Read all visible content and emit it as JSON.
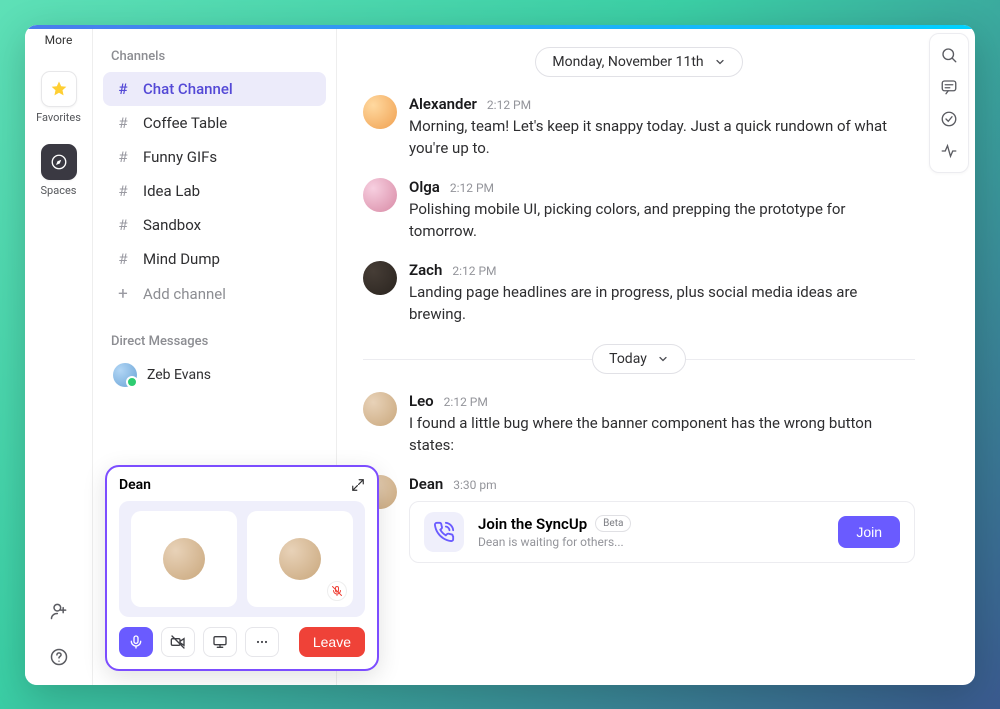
{
  "rail": {
    "more": "More",
    "favorites": "Favorites",
    "spaces": "Spaces"
  },
  "sidebar": {
    "channels_header": "Channels",
    "channels": [
      {
        "label": "Chat Channel",
        "active": true
      },
      {
        "label": "Coffee Table",
        "active": false
      },
      {
        "label": "Funny GIFs",
        "active": false
      },
      {
        "label": "Idea Lab",
        "active": false
      },
      {
        "label": "Sandbox",
        "active": false
      },
      {
        "label": "Mind Dump",
        "active": false
      }
    ],
    "add_channel": "Add channel",
    "dm_header": "Direct Messages",
    "dms": [
      {
        "label": "Zeb Evans"
      }
    ]
  },
  "chat": {
    "date1": "Monday, November 11th",
    "date2": "Today",
    "messages_a": [
      {
        "name": "Alexander",
        "time": "2:12 PM",
        "text": "Morning, team! Let's keep it snappy today. Just a quick rundown of what you're up to.",
        "avatar": "av-1"
      },
      {
        "name": "Olga",
        "time": "2:12 PM",
        "text": "Polishing mobile UI, picking colors, and prepping the prototype for tomorrow.",
        "avatar": "av-2"
      },
      {
        "name": "Zach",
        "time": "2:12 PM",
        "text": "Landing page headlines are in progress, plus social media ideas are brewing.",
        "avatar": "av-3"
      }
    ],
    "messages_b": [
      {
        "name": "Leo",
        "time": "2:12 PM",
        "text": "I found a little bug where the banner component has the wrong button states:",
        "avatar": "av-4"
      },
      {
        "name": "Dean",
        "time": "3:30 pm",
        "avatar": "av-5"
      }
    ],
    "call_card": {
      "title": "Join the SyncUp",
      "beta": "Beta",
      "sub": "Dean is waiting for others...",
      "join": "Join"
    }
  },
  "call_widget": {
    "title": "Dean",
    "leave": "Leave"
  }
}
